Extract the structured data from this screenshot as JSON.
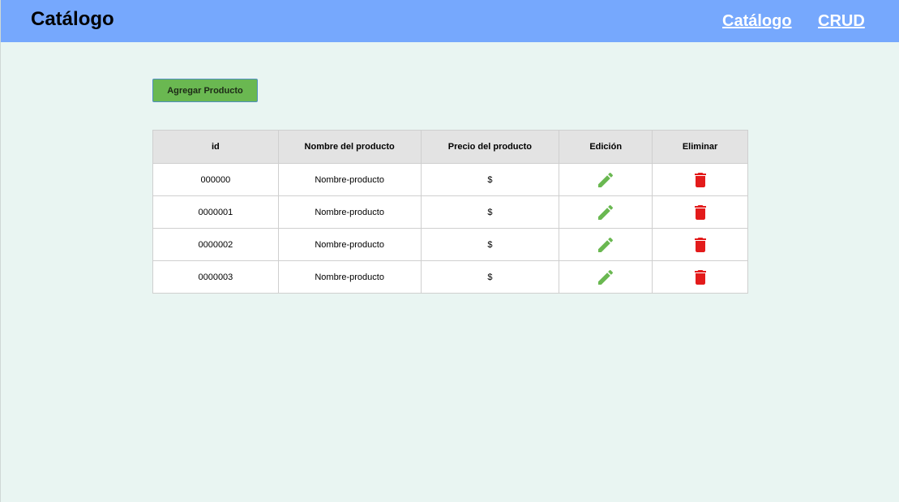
{
  "header": {
    "brand": "Catálogo",
    "nav": [
      {
        "label": "Catálogo"
      },
      {
        "label": "CRUD"
      }
    ]
  },
  "actions": {
    "add_label": "Agregar Producto"
  },
  "table": {
    "columns": [
      "id",
      "Nombre del producto",
      "Precio del producto",
      "Edición",
      "Eliminar"
    ],
    "rows": [
      {
        "id": "000000",
        "name": "Nombre-producto",
        "price": "$",
        "edit_icon": "pencil-icon",
        "delete_icon": "trash-icon"
      },
      {
        "id": "0000001",
        "name": "Nombre-producto",
        "price": "$",
        "edit_icon": "pencil-icon",
        "delete_icon": "trash-icon"
      },
      {
        "id": "0000002",
        "name": "Nombre-producto",
        "price": "$",
        "edit_icon": "pencil-icon",
        "delete_icon": "trash-icon"
      },
      {
        "id": "0000003",
        "name": "Nombre-producto",
        "price": "$",
        "edit_icon": "pencil-icon",
        "delete_icon": "trash-icon"
      }
    ]
  },
  "colors": {
    "navbar": "#76a8fd",
    "background": "#e9f5f2",
    "add_button": "#6ab851",
    "edit_icon": "#6ab851",
    "delete_icon": "#e31b1b"
  }
}
